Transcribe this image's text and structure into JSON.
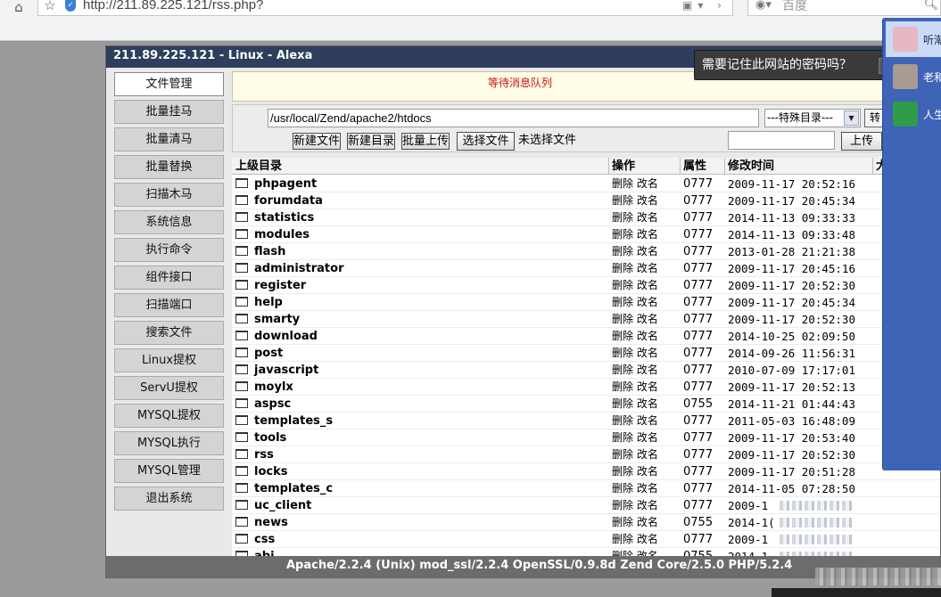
{
  "browser": {
    "url": "http://211.89.225.121/rss.php?",
    "search_placeholder": "百度",
    "home_icon": "home-icon",
    "star_icon": "star-icon"
  },
  "shell": {
    "title": "211.89.225.121 - Linux - Alexa",
    "menu": [
      {
        "label": "文件管理",
        "active": true
      },
      {
        "label": "批量挂马"
      },
      {
        "label": "批量清马"
      },
      {
        "label": "批量替换"
      },
      {
        "label": "扫描木马"
      },
      {
        "label": "系统信息"
      },
      {
        "label": "执行命令"
      },
      {
        "label": "组件接口"
      },
      {
        "label": "扫描端口"
      },
      {
        "label": "搜索文件"
      },
      {
        "label": "Linux提权"
      },
      {
        "label": "ServU提权"
      },
      {
        "label": "MYSQL提权"
      },
      {
        "label": "MYSQL执行"
      },
      {
        "label": "MYSQL管理"
      },
      {
        "label": "退出系统"
      }
    ],
    "status_message": "等待消息队列",
    "path_value": "/usr/local/Zend/apache2/htdocs",
    "special_dir_select": "---特殊目录---",
    "goto_button": "转",
    "buttons": {
      "new_file": "新建文件",
      "new_dir": "新建目录",
      "batch_upload": "批量上传",
      "choose_file": "选择文件",
      "no_file": "未选择文件",
      "upload": "上传"
    },
    "table": {
      "headers": {
        "name": "上级目录",
        "action": "操作",
        "perm": "属性",
        "time": "修改时间",
        "size": "大"
      },
      "rows": [
        {
          "name": "phpagent",
          "action": "删除 改名",
          "perm": "0777",
          "time": "2009-11-17 20:52:16"
        },
        {
          "name": "forumdata",
          "action": "删除 改名",
          "perm": "0777",
          "time": "2009-11-17 20:45:34"
        },
        {
          "name": "statistics",
          "action": "删除 改名",
          "perm": "0777",
          "time": "2014-11-13 09:33:33"
        },
        {
          "name": "modules",
          "action": "删除 改名",
          "perm": "0777",
          "time": "2014-11-13 09:33:48"
        },
        {
          "name": "flash",
          "action": "删除 改名",
          "perm": "0777",
          "time": "2013-01-28 21:21:38"
        },
        {
          "name": "administrator",
          "action": "删除 改名",
          "perm": "0777",
          "time": "2009-11-17 20:45:16"
        },
        {
          "name": "register",
          "action": "删除 改名",
          "perm": "0777",
          "time": "2009-11-17 20:52:30"
        },
        {
          "name": "help",
          "action": "删除 改名",
          "perm": "0777",
          "time": "2009-11-17 20:45:34"
        },
        {
          "name": "smarty",
          "action": "删除 改名",
          "perm": "0777",
          "time": "2009-11-17 20:52:30"
        },
        {
          "name": "download",
          "action": "删除 改名",
          "perm": "0777",
          "time": "2014-10-25 02:09:50"
        },
        {
          "name": "post",
          "action": "删除 改名",
          "perm": "0777",
          "time": "2014-09-26 11:56:31"
        },
        {
          "name": "javascript",
          "action": "删除 改名",
          "perm": "0777",
          "time": "2010-07-09 17:17:01"
        },
        {
          "name": "moylx",
          "action": "删除 改名",
          "perm": "0777",
          "time": "2009-11-17 20:52:13"
        },
        {
          "name": "aspsc",
          "action": "删除 改名",
          "perm": "0755",
          "time": "2014-11-21 01:44:43"
        },
        {
          "name": "templates_s",
          "action": "删除 改名",
          "perm": "0777",
          "time": "2011-05-03 16:48:09"
        },
        {
          "name": "tools",
          "action": "删除 改名",
          "perm": "0777",
          "time": "2009-11-17 20:53:40"
        },
        {
          "name": "rss",
          "action": "删除 改名",
          "perm": "0777",
          "time": "2009-11-17 20:52:30"
        },
        {
          "name": "locks",
          "action": "删除 改名",
          "perm": "0777",
          "time": "2009-11-17 20:51:28"
        },
        {
          "name": "templates_c",
          "action": "删除 改名",
          "perm": "0777",
          "time": "2014-11-05 07:28:50"
        },
        {
          "name": "uc_client",
          "action": "删除 改名",
          "perm": "0777",
          "time": "2009-1"
        },
        {
          "name": "news",
          "action": "删除 改名",
          "perm": "0755",
          "time": "2014-1("
        },
        {
          "name": "css",
          "action": "删除 改名",
          "perm": "0777",
          "time": "2009-1"
        },
        {
          "name": "abi",
          "action": "删除 改名",
          "perm": "0755",
          "time": "2014-1"
        }
      ]
    },
    "footer": "Apache/2.2.4 (Unix) mod_ssl/2.2.4 OpenSSL/0.9.8d Zend Core/2.5.0 PHP/5.2.4"
  },
  "password_popup": {
    "text": "需要记住此网站的密码吗？"
  },
  "side_panel": {
    "contacts": [
      {
        "name": "听潮",
        "avatar_color": "#e7b7c3",
        "selected": true
      },
      {
        "name": "老和",
        "avatar_color": "#a89b92"
      },
      {
        "name": "人生",
        "avatar_color": "#2e9c4a"
      }
    ]
  }
}
